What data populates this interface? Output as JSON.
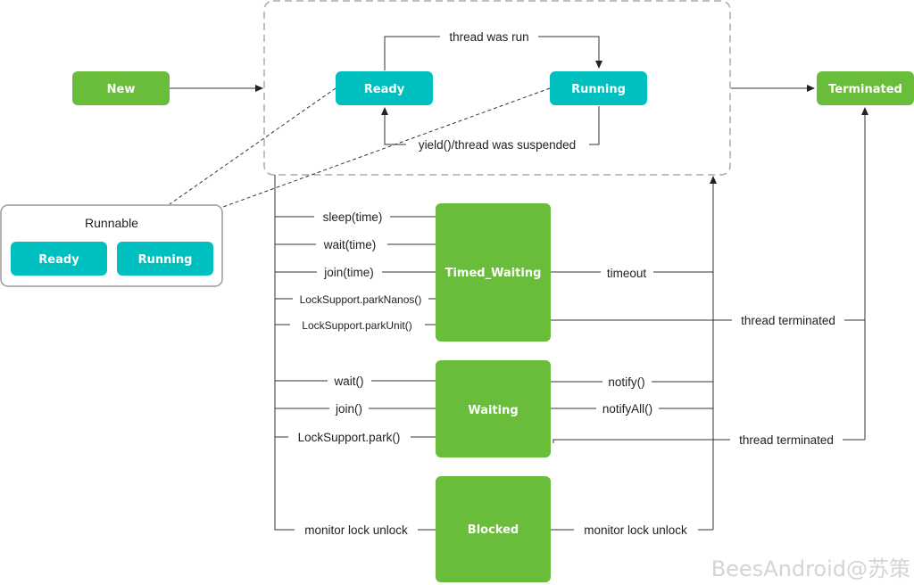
{
  "colors": {
    "green": "#6abd3a",
    "teal": "#00bfbf",
    "line": "#333333",
    "group_border": "#aaaaaa",
    "watermark": "#d4d4d4"
  },
  "nodes": {
    "new": "New",
    "ready": "Ready",
    "running": "Running",
    "terminated": "Terminated",
    "timed_waiting": "Timed_Waiting",
    "waiting": "Waiting",
    "blocked": "Blocked"
  },
  "runnable_legend": {
    "title": "Runnable",
    "ready": "Ready",
    "running": "Running"
  },
  "edges": {
    "thread_was_run": "thread was run",
    "yield": "yield()/thread was suspended",
    "sleep_time": "sleep(time)",
    "wait_time": "wait(time)",
    "join_time": "join(time)",
    "park_nanos": "LockSupport.parkNanos()",
    "park_unit": "LockSupport.parkUnit()",
    "timeout": "timeout",
    "thread_terminated_1": "thread terminated",
    "wait": "wait()",
    "join": "join()",
    "park": "LockSupport.park()",
    "notify": "notify()",
    "notify_all": "notifyAll()",
    "thread_terminated_2": "thread terminated",
    "monitor_unlock_in": "monitor lock unlock",
    "monitor_unlock_out": "monitor lock unlock"
  },
  "watermark": "BeesAndroid@苏策"
}
